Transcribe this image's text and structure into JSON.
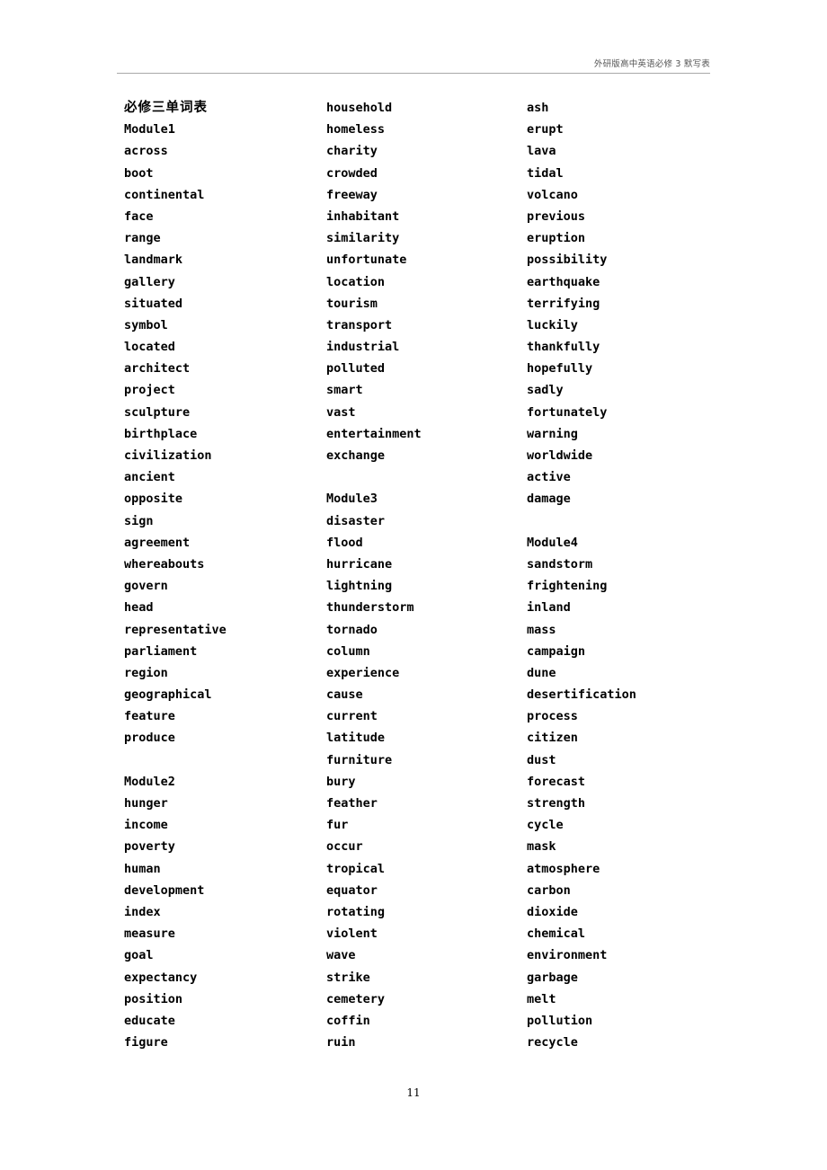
{
  "header": {
    "running_head": "外研版高中英语必修 3 默写表"
  },
  "footer": {
    "page_number": "11"
  },
  "document": {
    "title": "必修三单词表"
  },
  "columns": [
    {
      "name": "column-1",
      "lines": [
        "必修三单词表",
        "Module1",
        "across",
        "boot",
        "continental",
        "face",
        "range",
        "landmark",
        "gallery",
        "situated",
        "symbol",
        "located",
        "architect",
        "project",
        "sculpture",
        "birthplace",
        "civilization",
        "ancient",
        "opposite",
        "sign",
        "agreement",
        "whereabouts",
        "govern",
        "head",
        "representative",
        "parliament",
        "region",
        "geographical",
        "feature",
        "produce",
        "",
        "Module2",
        "hunger",
        "income",
        "poverty",
        "human",
        "development",
        "index",
        "measure",
        "goal",
        "expectancy",
        "position",
        "educate",
        "figure"
      ]
    },
    {
      "name": "column-2",
      "lines": [
        "household",
        "homeless",
        "charity",
        "crowded",
        "freeway",
        "inhabitant",
        "similarity",
        "unfortunate",
        "location",
        "tourism",
        "transport",
        "industrial",
        "polluted",
        "smart",
        "vast",
        "entertainment",
        "exchange",
        "",
        "Module3",
        "disaster",
        "flood",
        "hurricane",
        "lightning",
        "thunderstorm",
        "tornado",
        "column",
        "experience",
        "cause",
        "current",
        "latitude",
        "furniture",
        "bury",
        "feather",
        "fur",
        "occur",
        "tropical",
        "equator",
        "rotating",
        "violent",
        "wave",
        "strike",
        "cemetery",
        "coffin",
        "ruin"
      ]
    },
    {
      "name": "column-3",
      "lines": [
        "ash",
        "erupt",
        "lava",
        "tidal",
        "volcano",
        "previous",
        "eruption",
        "possibility",
        "earthquake",
        "terrifying",
        "luckily",
        "thankfully",
        "hopefully",
        "sadly",
        "fortunately",
        "warning",
        "worldwide",
        "active",
        "damage",
        "",
        "Module4",
        "sandstorm",
        "frightening",
        "inland",
        "mass",
        "campaign",
        "dune",
        "desertification",
        "process",
        "citizen",
        "dust",
        "forecast",
        "strength",
        "cycle",
        "mask",
        "atmosphere",
        "carbon",
        "dioxide",
        "chemical",
        "environment",
        "garbage",
        "melt",
        "pollution",
        "recycle"
      ]
    }
  ]
}
